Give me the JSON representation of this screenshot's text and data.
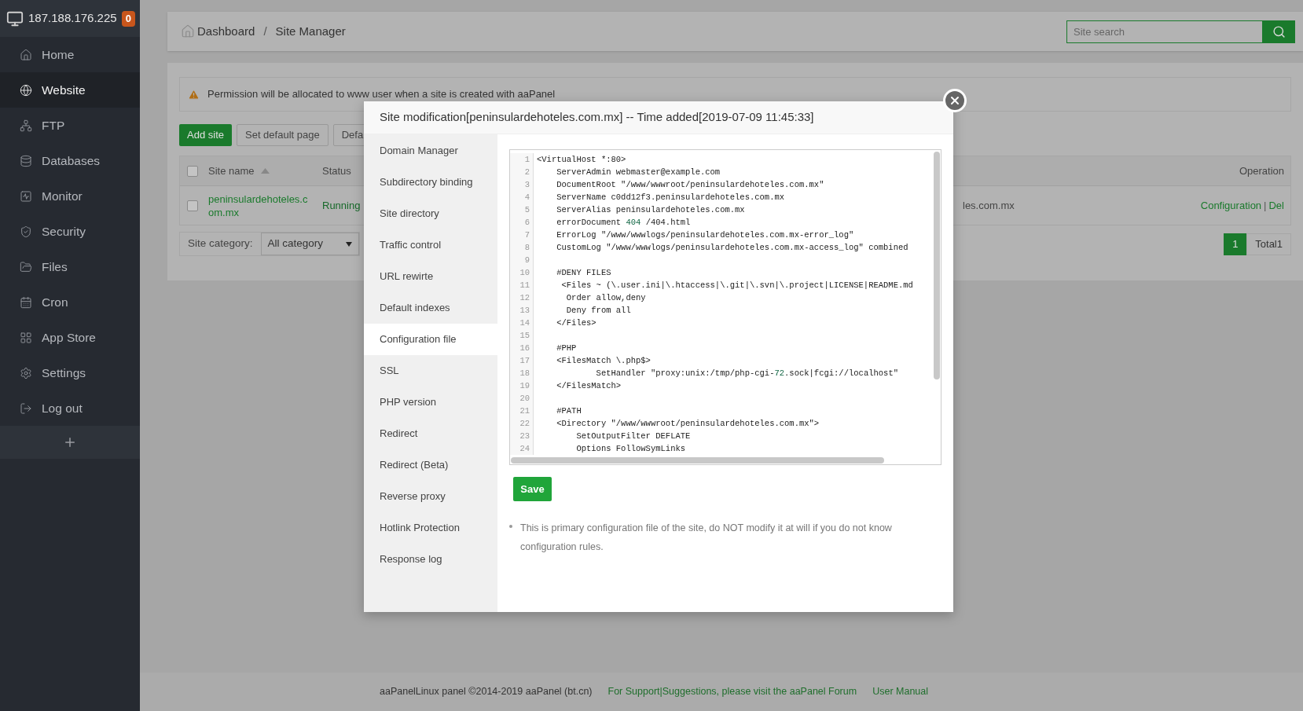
{
  "sidebar": {
    "server_ip": "187.188.176.225",
    "badge": "0",
    "items": [
      {
        "label": "Home",
        "selected": false
      },
      {
        "label": "Website",
        "selected": true
      },
      {
        "label": "FTP",
        "selected": false
      },
      {
        "label": "Databases",
        "selected": false
      },
      {
        "label": "Monitor",
        "selected": false
      },
      {
        "label": "Security",
        "selected": false
      },
      {
        "label": "Files",
        "selected": false
      },
      {
        "label": "Cron",
        "selected": false
      },
      {
        "label": "App Store",
        "selected": false
      },
      {
        "label": "Settings",
        "selected": false
      },
      {
        "label": "Log out",
        "selected": false
      }
    ]
  },
  "breadcrumb": {
    "items": [
      "Dashboard",
      "Site Manager"
    ],
    "separator": "/"
  },
  "search": {
    "placeholder": "Site search"
  },
  "notice": "Permission will be allocated to www user when a site is created with aaPanel",
  "toolbar_buttons": [
    {
      "label": "Add site",
      "kind": "primary"
    },
    {
      "label": "Set default page",
      "kind": "default"
    },
    {
      "label": "Defa",
      "kind": "default"
    }
  ],
  "table": {
    "columns": [
      "Site name",
      "Status",
      "Operation"
    ],
    "header_checked": false,
    "rows": [
      {
        "checked": false,
        "name": "peninsulardehoteles.com.mx",
        "status": "Running",
        "column_4": "les.com.mx",
        "actions": [
          "Configuration",
          "Del"
        ],
        "action_separator": "|"
      }
    ]
  },
  "category": {
    "label": "Site category:",
    "value": "All category"
  },
  "pagination": {
    "pages": [
      {
        "label": "1",
        "selected": true
      }
    ],
    "total": "Total1"
  },
  "modal": {
    "title": "Site modification[peninsulardehoteles.com.mx] -- Time added[2019-07-09 11:45:33]",
    "nav": [
      {
        "label": "Domain Manager",
        "selected": false
      },
      {
        "label": "Subdirectory binding",
        "selected": false
      },
      {
        "label": "Site directory",
        "selected": false
      },
      {
        "label": "Traffic control",
        "selected": false
      },
      {
        "label": "URL rewirte",
        "selected": false
      },
      {
        "label": "Default indexes",
        "selected": false
      },
      {
        "label": "Configuration file",
        "selected": true
      },
      {
        "label": "SSL",
        "selected": false
      },
      {
        "label": "PHP version",
        "selected": false
      },
      {
        "label": "Redirect",
        "selected": false
      },
      {
        "label": "Redirect (Beta)",
        "selected": false
      },
      {
        "label": "Reverse proxy",
        "selected": false
      },
      {
        "label": "Hotlink Protection",
        "selected": false
      },
      {
        "label": "Response log",
        "selected": false
      }
    ],
    "code_lines": [
      {
        "number": "1",
        "parts": [
          {
            "kind": "plain",
            "text": "<VirtualHost *:80>"
          }
        ]
      },
      {
        "number": "2",
        "parts": [
          {
            "kind": "plain",
            "text": "    ServerAdmin webmaster@example.com"
          }
        ]
      },
      {
        "number": "3",
        "parts": [
          {
            "kind": "plain",
            "text": "    DocumentRoot \"/www/wwwroot/peninsulardehoteles.com.mx\""
          }
        ]
      },
      {
        "number": "4",
        "parts": [
          {
            "kind": "plain",
            "text": "    ServerName c0dd12f3.peninsulardehoteles.com.mx"
          }
        ]
      },
      {
        "number": "5",
        "parts": [
          {
            "kind": "plain",
            "text": "    ServerAlias peninsulardehoteles.com.mx"
          }
        ]
      },
      {
        "number": "6",
        "parts": [
          {
            "kind": "plain",
            "text": "    errorDocument "
          },
          {
            "kind": "number",
            "text": "404"
          },
          {
            "kind": "plain",
            "text": " /404.html"
          }
        ]
      },
      {
        "number": "7",
        "parts": [
          {
            "kind": "plain",
            "text": "    ErrorLog \"/www/wwwlogs/peninsulardehoteles.com.mx-error_log\""
          }
        ]
      },
      {
        "number": "8",
        "parts": [
          {
            "kind": "plain",
            "text": "    CustomLog \"/www/wwwlogs/peninsulardehoteles.com.mx-access_log\" combined"
          }
        ]
      },
      {
        "number": "9"
      },
      {
        "number": "10",
        "parts": [
          {
            "kind": "plain",
            "text": "    #DENY FILES"
          }
        ]
      },
      {
        "number": "11",
        "parts": [
          {
            "kind": "plain",
            "text": "     <Files ~ (\\.user.ini|\\.htaccess|\\.git|\\.svn|\\.project|LICENSE|README.md"
          }
        ]
      },
      {
        "number": "12",
        "parts": [
          {
            "kind": "plain",
            "text": "      Order allow,deny"
          }
        ]
      },
      {
        "number": "13",
        "parts": [
          {
            "kind": "plain",
            "text": "      Deny from all"
          }
        ]
      },
      {
        "number": "14",
        "parts": [
          {
            "kind": "plain",
            "text": "    </Files>"
          }
        ]
      },
      {
        "number": "15"
      },
      {
        "number": "16",
        "parts": [
          {
            "kind": "plain",
            "text": "    #PHP"
          }
        ]
      },
      {
        "number": "17",
        "parts": [
          {
            "kind": "plain",
            "text": "    <FilesMatch \\.php$>"
          }
        ]
      },
      {
        "number": "18",
        "parts": [
          {
            "kind": "plain",
            "text": "            SetHandler \"proxy:unix:/tmp/php-cgi-"
          },
          {
            "kind": "number",
            "text": "72"
          },
          {
            "kind": "plain",
            "text": ".sock|fcgi://localhost\""
          }
        ]
      },
      {
        "number": "19",
        "parts": [
          {
            "kind": "plain",
            "text": "    </FilesMatch>"
          }
        ]
      },
      {
        "number": "20"
      },
      {
        "number": "21",
        "parts": [
          {
            "kind": "plain",
            "text": "    #PATH"
          }
        ]
      },
      {
        "number": "22",
        "parts": [
          {
            "kind": "plain",
            "text": "    <Directory \"/www/wwwroot/peninsulardehoteles.com.mx\">"
          }
        ]
      },
      {
        "number": "23",
        "parts": [
          {
            "kind": "plain",
            "text": "        SetOutputFilter DEFLATE"
          }
        ]
      },
      {
        "number": "24",
        "parts": [
          {
            "kind": "plain",
            "text": "        Options FollowSymLinks"
          }
        ]
      }
    ],
    "save": "Save",
    "note": "This is primary configuration file of the site, do NOT modify it at will if you do not know configuration rules."
  },
  "footer": {
    "copyright": "aaPanelLinux panel ©2014-2019 aaPanel (bt.cn)",
    "support_link": "For Support|Suggestions, please visit the aaPanel Forum",
    "manual_link": "User Manual"
  }
}
